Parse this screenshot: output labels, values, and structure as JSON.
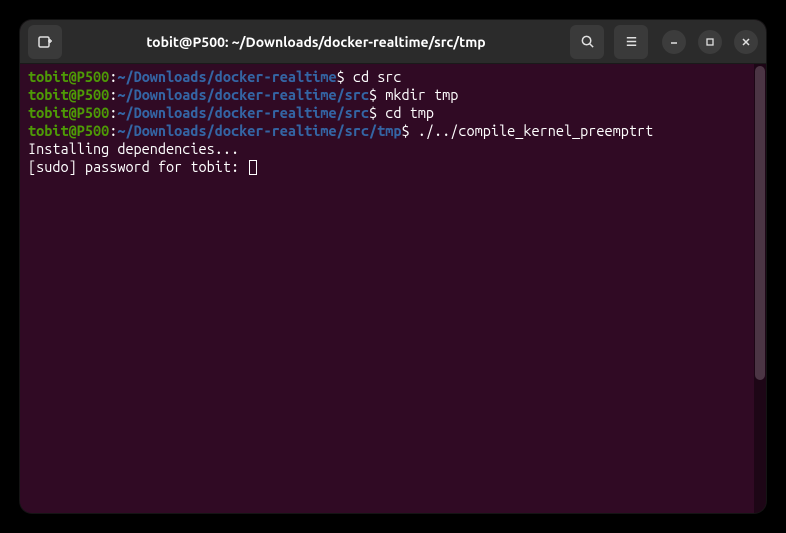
{
  "window": {
    "title": "tobit@P500: ~/Downloads/docker-realtime/src/tmp"
  },
  "terminal": {
    "lines": [
      {
        "user_host": "tobit@P500",
        "cwd": "~/Downloads/docker-realtime",
        "command": "cd src"
      },
      {
        "user_host": "tobit@P500",
        "cwd": "~/Downloads/docker-realtime/src",
        "command": "mkdir tmp"
      },
      {
        "user_host": "tobit@P500",
        "cwd": "~/Downloads/docker-realtime/src",
        "command": "cd tmp"
      },
      {
        "user_host": "tobit@P500",
        "cwd": "~/Downloads/docker-realtime/src/tmp",
        "command": "./../compile_kernel_preemptrt"
      }
    ],
    "output": [
      "Installing dependencies...",
      "[sudo] password for tobit: "
    ]
  },
  "icons": {
    "new_tab": "new-tab",
    "search": "search",
    "menu": "menu",
    "minimize": "minimize",
    "maximize": "maximize",
    "close": "close"
  }
}
